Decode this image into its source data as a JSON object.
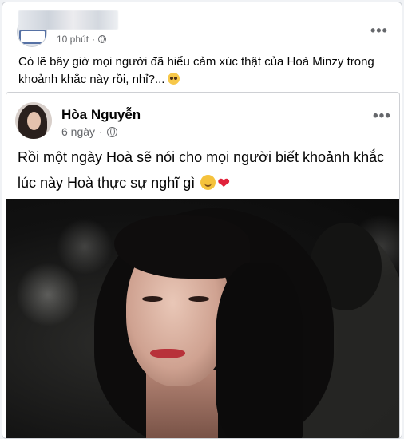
{
  "outer_post": {
    "time": "10 phút",
    "dot": "·",
    "text": "Có lẽ bây giờ mọi người đã hiểu cảm xúc thật của Hoà Minzy trong khoảnh khắc này rồi, nhỉ?...",
    "more": "•••"
  },
  "shared_post": {
    "author": "Hòa Nguyễn",
    "time": "6 ngày",
    "dot": "·",
    "text": "Rồi một ngày Hoà sẽ nói cho mọi người biết khoảnh khắc lúc này Hoà thực sự nghĩ gì",
    "more": "•••"
  },
  "icons": {
    "privacy": "globe-icon",
    "options": "more-options-icon",
    "emoji_outer": "pleading-face-emoji",
    "emoji_smile": "smiling-face-emoji",
    "emoji_heart": "red-heart-emoji"
  },
  "colors": {
    "text": "#050505",
    "secondary_text": "#65676b",
    "heart": "#e0223b"
  }
}
